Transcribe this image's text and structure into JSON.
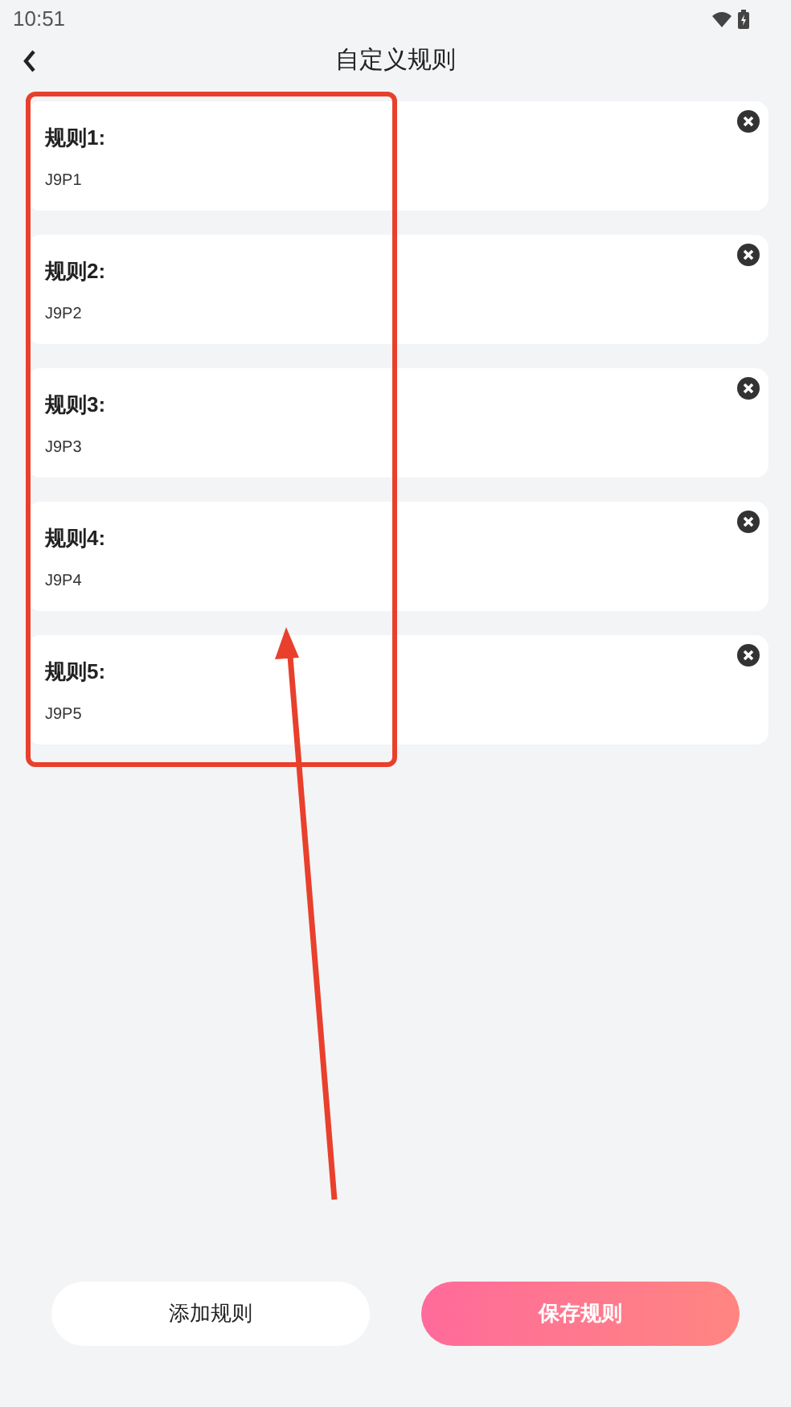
{
  "status_bar": {
    "time": "10:51"
  },
  "header": {
    "title": "自定义规则"
  },
  "rules": [
    {
      "label": "规则1:",
      "value": "J9P1"
    },
    {
      "label": "规则2:",
      "value": "J9P2"
    },
    {
      "label": "规则3:",
      "value": "J9P3"
    },
    {
      "label": "规则4:",
      "value": "J9P4"
    },
    {
      "label": "规则5:",
      "value": "J9P5"
    }
  ],
  "buttons": [
    {
      "label": "添加规则",
      "kind": "secondary"
    },
    {
      "label": "保存规则",
      "kind": "primary"
    }
  ]
}
